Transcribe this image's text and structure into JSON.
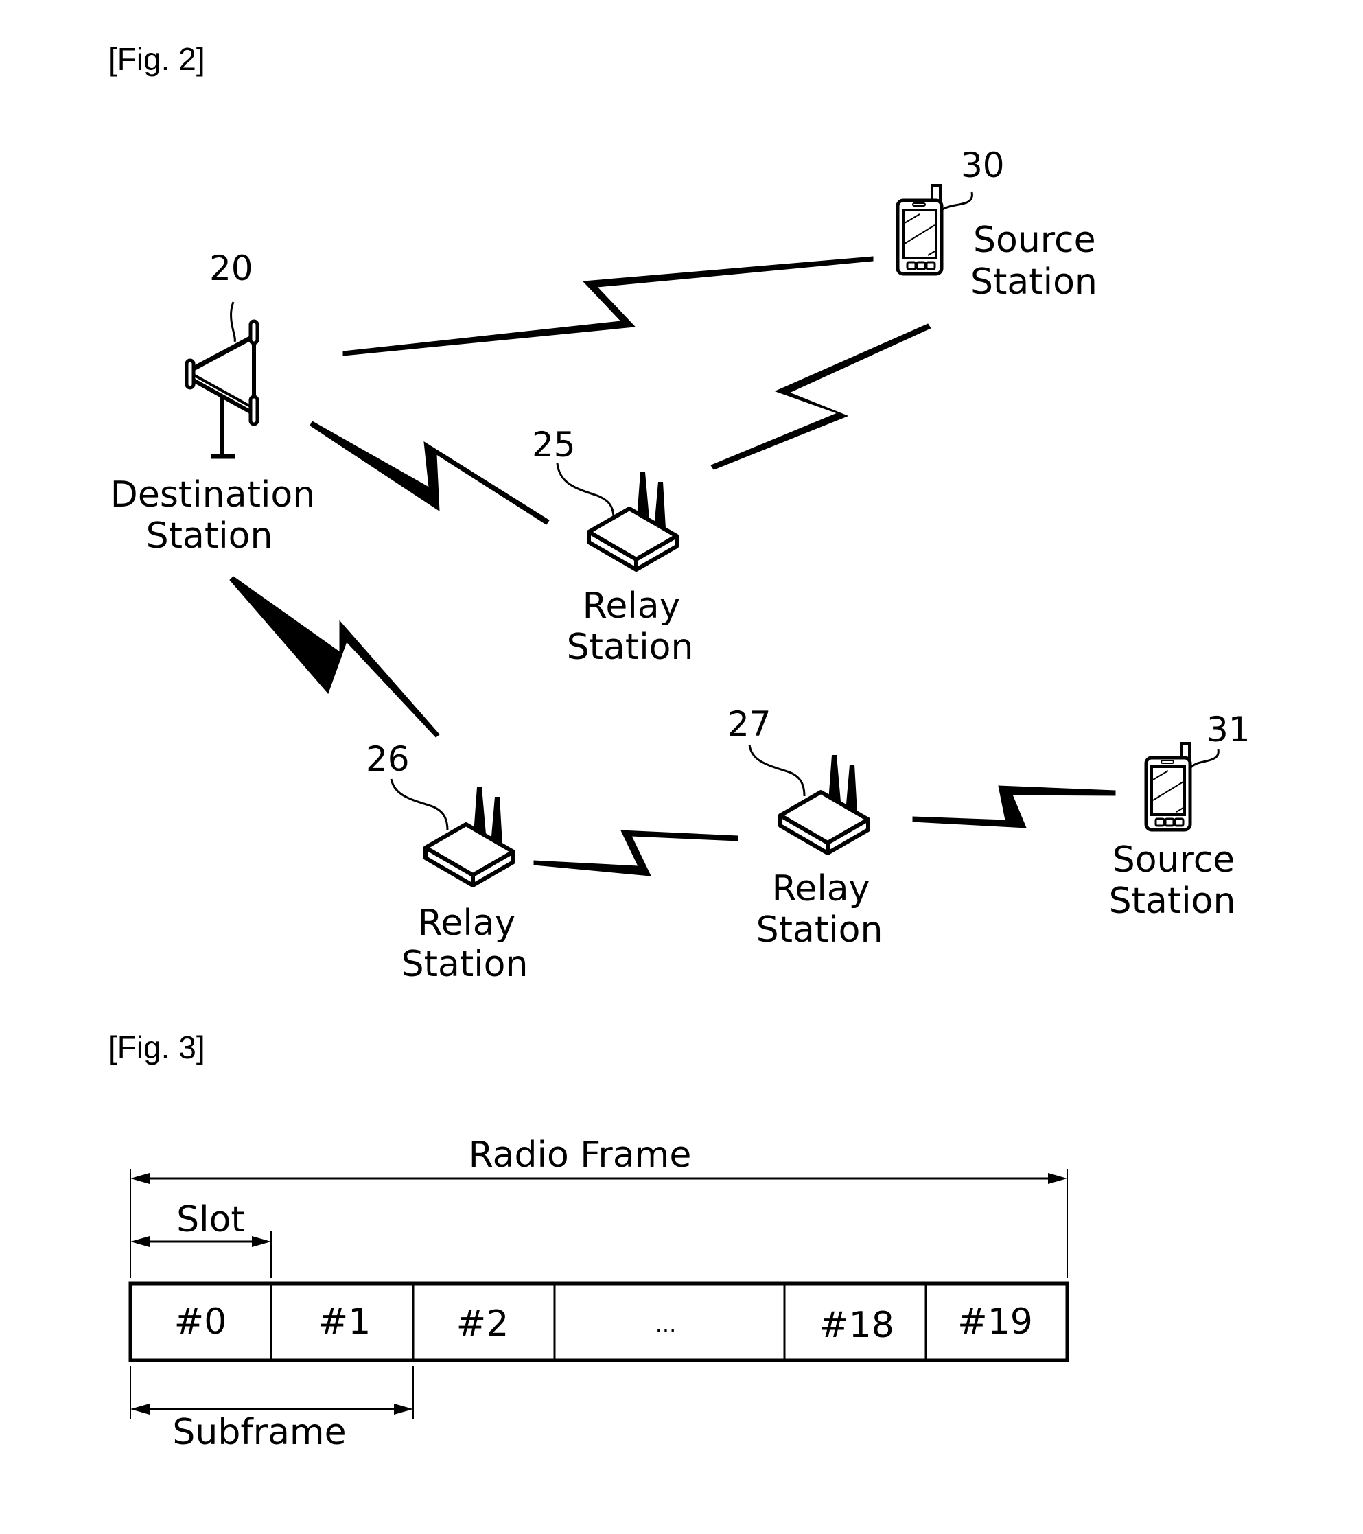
{
  "fig2": {
    "caption": "[Fig. 2]",
    "nodes": {
      "destination": {
        "ref": "20",
        "line1": "Destination",
        "line2": "Station",
        "icon": "base-station-antenna-icon"
      },
      "source_30": {
        "ref": "30",
        "line1": "Source",
        "line2": "Station",
        "icon": "mobile-phone-icon"
      },
      "relay_25": {
        "ref": "25",
        "line1": "Relay",
        "line2": "Station",
        "icon": "wireless-router-icon"
      },
      "relay_26": {
        "ref": "26",
        "line1": "Relay",
        "line2": "Station",
        "icon": "wireless-router-icon"
      },
      "relay_27": {
        "ref": "27",
        "line1": "Relay",
        "line2": "Station",
        "icon": "wireless-router-icon"
      },
      "source_31": {
        "ref": "31",
        "line1": "Source",
        "line2": "Station",
        "icon": "mobile-phone-icon"
      }
    },
    "links": [
      {
        "from": "destination",
        "to": "source_30"
      },
      {
        "from": "source_30",
        "to": "relay_25"
      },
      {
        "from": "destination",
        "to": "relay_25"
      },
      {
        "from": "destination",
        "to": "relay_26"
      },
      {
        "from": "relay_26",
        "to": "relay_27"
      },
      {
        "from": "relay_27",
        "to": "source_31"
      }
    ]
  },
  "fig3": {
    "caption": "[Fig. 3]",
    "radio_frame_label": "Radio Frame",
    "slot_label": "Slot",
    "subframe_label": "Subframe",
    "cells": [
      "#0",
      "#1",
      "#2",
      "...",
      "#18",
      "#19"
    ]
  }
}
